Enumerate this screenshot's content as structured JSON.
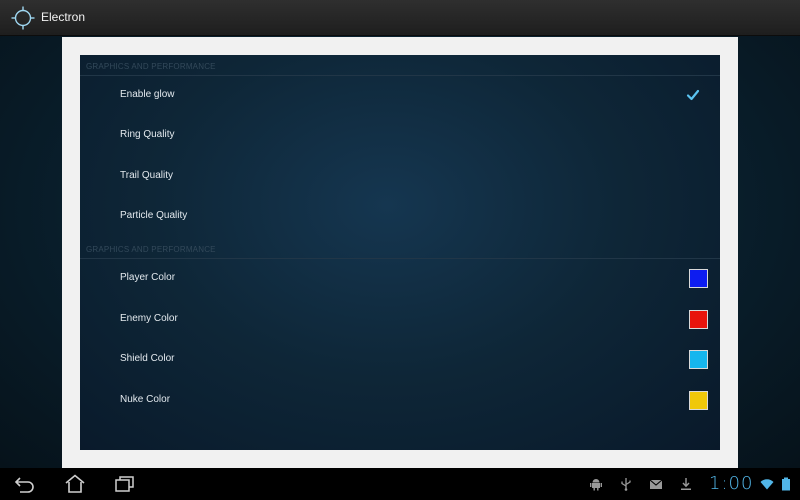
{
  "app": {
    "title": "Electron"
  },
  "sections": [
    {
      "header": "GRAPHICS AND PERFORMANCE"
    },
    {
      "header": "GRAPHICS AND PERFORMANCE"
    }
  ],
  "prefs": {
    "enable_glow": {
      "label": "Enable glow",
      "checked": true
    },
    "ring_quality": {
      "label": "Ring Quality"
    },
    "trail_quality": {
      "label": "Trail Quality"
    },
    "particle_quality": {
      "label": "Particle Quality"
    },
    "player_color": {
      "label": "Player Color",
      "color": "#0d1cf0"
    },
    "enemy_color": {
      "label": "Enemy Color",
      "color": "#e8140c"
    },
    "shield_color": {
      "label": "Shield Color",
      "color": "#16b6ee"
    },
    "nuke_color": {
      "label": "Nuke Color",
      "color": "#f0c80a"
    }
  },
  "system": {
    "clock": "1:00",
    "nav_icons": [
      "back-icon",
      "home-icon",
      "recent-apps-icon"
    ],
    "status_icons": [
      "android-debug-icon",
      "usb-icon",
      "gmail-icon",
      "download-icon",
      "wifi-icon",
      "battery-icon"
    ]
  },
  "colors": {
    "accent": "#52b6e8"
  }
}
